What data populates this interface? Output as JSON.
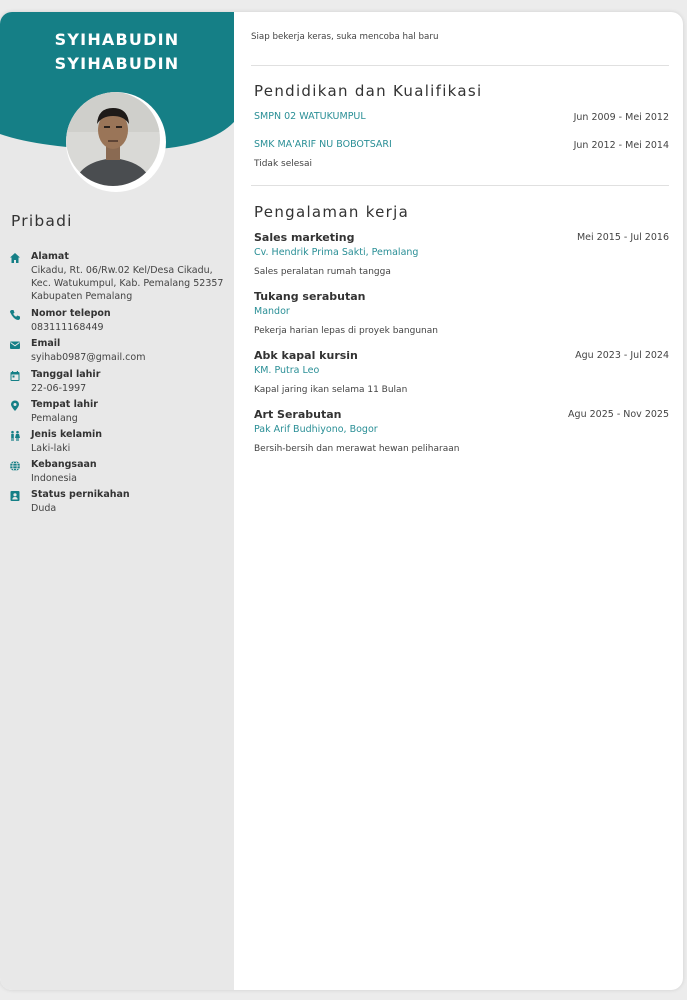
{
  "colors": {
    "accent": "#157f86",
    "link": "#2a8f96",
    "sidebar_bg": "#e8e8e8"
  },
  "profile": {
    "name_line1": "SYIHABUDIN",
    "name_line2": "SYIHABUDIN"
  },
  "personal": {
    "heading": "Pribadi",
    "items": [
      {
        "icon": "home-icon",
        "label": "Alamat",
        "value": "Cikadu, Rt. 06/Rw.02 Kel/Desa Cikadu, Kec. Watukumpul, Kab. Pemalang 52357 Kabupaten Pemalang"
      },
      {
        "icon": "phone-icon",
        "label": "Nomor telepon",
        "value": "083111168449"
      },
      {
        "icon": "email-icon",
        "label": "Email",
        "value": "syihab0987@gmail.com"
      },
      {
        "icon": "calendar-icon",
        "label": "Tanggal lahir",
        "value": "22-06-1997"
      },
      {
        "icon": "location-pin-icon",
        "label": "Tempat lahir",
        "value": "Pemalang"
      },
      {
        "icon": "gender-icon",
        "label": "Jenis kelamin",
        "value": "Laki-laki"
      },
      {
        "icon": "globe-icon",
        "label": "Kebangsaan",
        "value": "Indonesia"
      },
      {
        "icon": "id-badge-icon",
        "label": "Status pernikahan",
        "value": "Duda"
      }
    ]
  },
  "summary": "Siap bekerja keras, suka mencoba hal baru",
  "education": {
    "heading": "Pendidikan dan Kualifikasi",
    "items": [
      {
        "school": "SMPN 02 WATUKUMPUL",
        "dates": "Jun 2009 - Mei 2012",
        "note": ""
      },
      {
        "school": "SMK MA'ARIF NU BOBOTSARI",
        "dates": "Jun 2012 - Mei 2014",
        "note": "Tidak selesai"
      }
    ]
  },
  "experience": {
    "heading": "Pengalaman kerja",
    "items": [
      {
        "title": "Sales marketing",
        "org": "Cv. Hendrik Prima Sakti, Pemalang",
        "dates": "Mei 2015 - Jul 2016",
        "desc": "Sales peralatan rumah tangga"
      },
      {
        "title": "Tukang serabutan",
        "org": "Mandor",
        "dates": "",
        "desc": "Pekerja harian lepas di proyek bangunan"
      },
      {
        "title": "Abk kapal kursin",
        "org": "KM. Putra Leo",
        "dates": "Agu 2023 - Jul 2024",
        "desc": "Kapal jaring ikan selama 11 Bulan"
      },
      {
        "title": "Art Serabutan",
        "org": "Pak Arif Budhiyono, Bogor",
        "dates": "Agu 2025 - Nov 2025",
        "desc": "Bersih-bersih dan merawat hewan peliharaan"
      }
    ]
  }
}
